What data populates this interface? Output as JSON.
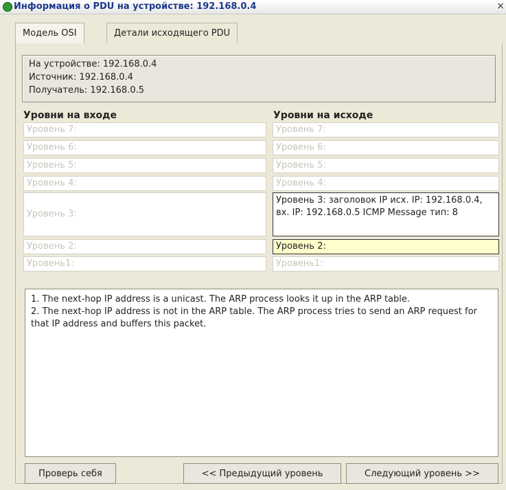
{
  "window": {
    "title": "Информация о PDU на устройстве: 192.168.0.4",
    "close_glyph": "×",
    "icon": "app-icon"
  },
  "tabs": [
    {
      "label": "Модель OSI",
      "active": true
    },
    {
      "label": "Детали исходящего PDU",
      "active": false
    }
  ],
  "device_info": {
    "at_device": "На устройстве: 192.168.0.4",
    "source": "Источник: 192.168.0.4",
    "destination": "Получатель: 192.168.0.5"
  },
  "in_layers": {
    "header": "Уровни на входе",
    "items": [
      "Уровень 7:",
      "Уровень 6:",
      "Уровень 5:",
      "Уровень 4:",
      "Уровень 3:",
      "Уровень 2:",
      "Уровень1:"
    ]
  },
  "out_layers": {
    "header": "Уровни на исходе",
    "items": [
      "Уровень 7:",
      "Уровень 6:",
      "Уровень 5:",
      "Уровень 4:",
      "Уровень 3: заголовок IP исх. IP: 192.168.0.4, вх. IP: 192.168.0.5 ICMP Message тип: 8",
      "Уровень 2:",
      "Уровень1:"
    ]
  },
  "description": {
    "line1": "1. The next-hop IP address is a unicast. The ARP process looks it up in the ARP table.",
    "line2": "2. The next-hop IP address is not in the ARP table. The ARP process tries to send an ARP request for that IP address and buffers this packet."
  },
  "buttons": {
    "check_yourself": "Проверь себя",
    "prev_layer": "<< Предыдущий уровень",
    "next_layer": "Следующий уровень >>"
  },
  "colors": {
    "title_text": "#1a3a8a",
    "current_layer_bg": "#ffffcc",
    "disabled_text": "#c8c5bd"
  }
}
